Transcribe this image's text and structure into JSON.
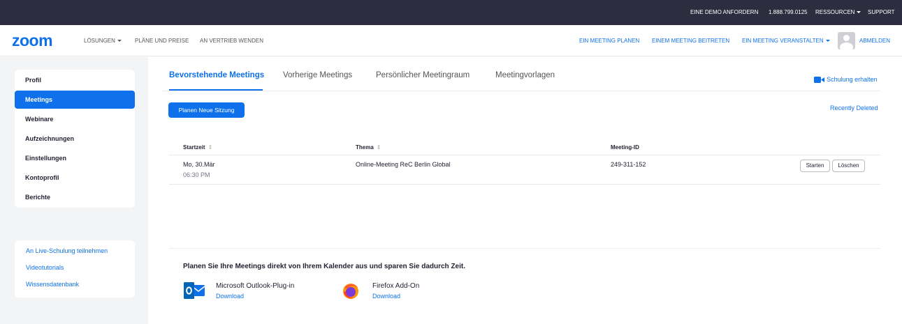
{
  "topbar": {
    "demo": "EINE DEMO ANFORDERN",
    "phone": "1.888.799.0125",
    "resources": "RESSOURCEN",
    "support": "SUPPORT"
  },
  "nav": {
    "logo": "zoom",
    "solutions": "LÖSUNGEN",
    "plans": "PLÄNE UND PREISE",
    "sales": "AN VERTRIEB WENDEN",
    "schedule": "EIN MEETING PLANEN",
    "join": "EINEM MEETING BEITRETEN",
    "host": "EIN MEETING VERANSTALTEN",
    "signout": "ABMELDEN"
  },
  "sidebar": {
    "items": [
      {
        "label": "Profil"
      },
      {
        "label": "Meetings"
      },
      {
        "label": "Webinare"
      },
      {
        "label": "Aufzeichnungen"
      },
      {
        "label": "Einstellungen"
      },
      {
        "label": "Kontoprofil"
      },
      {
        "label": "Berichte"
      }
    ],
    "links": [
      {
        "label": "An Live-Schulung teilnehmen"
      },
      {
        "label": "Videotutorials"
      },
      {
        "label": "Wissensdatenbank"
      }
    ]
  },
  "tabs": [
    {
      "label": "Bevorstehende Meetings"
    },
    {
      "label": "Vorherige Meetings"
    },
    {
      "label": "Persönlicher Meetingraum"
    },
    {
      "label": "Meetingvorlagen"
    }
  ],
  "training": "Schulung erhalten",
  "recently_deleted": "Recently Deleted",
  "schedule_button": "Planen Neue Sitzung",
  "table": {
    "headers": {
      "start": "Startzeit",
      "topic": "Thema",
      "id": "Meeting-ID"
    },
    "sort_glyph": "⇕",
    "rows": [
      {
        "date": "Mo, 30.Mär",
        "time": "06:30 PM",
        "topic": "Online-Meeting ReC Berlin Global",
        "meeting_id": "249-311-152",
        "start_btn": "Starten",
        "delete_btn": "Löschen"
      }
    ]
  },
  "calendar": {
    "title": "Planen Sie Ihre Meetings direkt von Ihrem Kalender aus und sparen Sie dadurch Zeit.",
    "plugins": [
      {
        "name": "Microsoft Outlook-Plug-in",
        "download": "Download",
        "icon": "outlook-icon"
      },
      {
        "name": "Firefox Add-On",
        "download": "Download",
        "icon": "firefox-icon"
      }
    ]
  },
  "colors": {
    "accent": "#0e71eb",
    "topbar": "#2d2d3f",
    "sidebar_bg": "#f3f4f6"
  }
}
